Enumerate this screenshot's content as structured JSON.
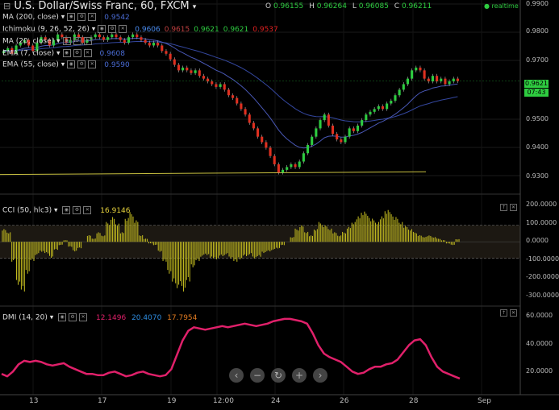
{
  "header": {
    "title": "U.S. Dollar/Swiss Franc, 60, FXCM",
    "ohlc": {
      "o_label": "O",
      "o": "0.96155",
      "h_label": "H",
      "h": "0.96264",
      "l_label": "L",
      "l": "0.96085",
      "c_label": "C",
      "c": "0.96211"
    },
    "realtime": "realtime"
  },
  "indicators": [
    {
      "label": "MA (200, close)",
      "values": [
        "0.9542"
      ],
      "colors": [
        "#4a6cd4"
      ]
    },
    {
      "label": "Ichimoku (9, 26, 52, 26)",
      "values": [
        "0.9606",
        "0.9615",
        "0.9621",
        "0.9621",
        "0.9537"
      ],
      "colors": [
        "#4a8cf0",
        "#c04040",
        "#2ecc40",
        "#2ecc40",
        "#e02020"
      ]
    },
    {
      "label": "MA (20, close)",
      "values": [],
      "colors": []
    },
    {
      "label": "EMA (7, close)",
      "values": [
        "0.9608"
      ],
      "colors": [
        "#4a6cd4"
      ]
    },
    {
      "label": "EMA (55, close)",
      "values": [
        "0.9590"
      ],
      "colors": [
        "#4a6cd4"
      ]
    }
  ],
  "cci_panel": {
    "label": "CCI (50, hlc3)",
    "value": "16.9146",
    "value_color": "#e6d23c"
  },
  "dmi_panel": {
    "label": "DMI (14, 20)",
    "values": [
      "12.1496",
      "20.4070",
      "17.7954"
    ],
    "colors": [
      "#e0206a",
      "#2e8ce0",
      "#e07a20"
    ]
  },
  "price_axis": {
    "ticks": [
      "0.9900",
      "0.9800",
      "0.9700",
      "0.9500",
      "0.9400",
      "0.9300"
    ],
    "price_tag": "0.9621",
    "time_tag": "07:43"
  },
  "cci_axis": {
    "ticks": [
      "200.0000",
      "100.0000",
      "0.0000",
      "-100.0000",
      "-200.0000",
      "-300.0000"
    ]
  },
  "dmi_axis": {
    "ticks": [
      "60.0000",
      "40.0000",
      "20.0000"
    ]
  },
  "x_axis": {
    "ticks": [
      "13",
      "17",
      "19",
      "12:00",
      "24",
      "26",
      "28",
      "Sep"
    ]
  },
  "nav_buttons": [
    "‹",
    "−",
    "↻",
    "+",
    "›"
  ],
  "colors": {
    "bull": "#2ecc40",
    "bear": "#e03020",
    "ma": "#3a4fb0",
    "trend": "#c8c040",
    "cci": "#c8c020",
    "dmi": "#e0206a"
  },
  "chart_data": [
    {
      "type": "candlestick",
      "title": "U.S. Dollar/Swiss Franc, 60, FXCM",
      "ylim": [
        0.925,
        0.99
      ],
      "close": [
        0.973,
        0.974,
        0.972,
        0.975,
        0.976,
        0.977,
        0.975,
        0.973,
        0.976,
        0.978,
        0.977,
        0.975,
        0.977,
        0.979,
        0.978,
        0.976,
        0.977,
        0.979,
        0.978,
        0.976,
        0.977,
        0.978,
        0.979,
        0.978,
        0.977,
        0.978,
        0.979,
        0.978,
        0.977,
        0.976,
        0.978,
        0.979,
        0.978,
        0.977,
        0.976,
        0.975,
        0.976,
        0.975,
        0.973,
        0.972,
        0.97,
        0.968,
        0.966,
        0.967,
        0.966,
        0.965,
        0.966,
        0.964,
        0.963,
        0.962,
        0.961,
        0.96,
        0.961,
        0.959,
        0.957,
        0.956,
        0.954,
        0.952,
        0.95,
        0.947,
        0.945,
        0.942,
        0.94,
        0.938,
        0.935,
        0.932,
        0.929,
        0.93,
        0.931,
        0.932,
        0.931,
        0.933,
        0.936,
        0.939,
        0.942,
        0.945,
        0.948,
        0.95,
        0.946,
        0.943,
        0.941,
        0.94,
        0.942,
        0.945,
        0.944,
        0.946,
        0.948,
        0.95,
        0.951,
        0.952,
        0.953,
        0.952,
        0.954,
        0.955,
        0.957,
        0.959,
        0.961,
        0.963,
        0.966,
        0.967,
        0.966,
        0.963,
        0.962,
        0.964,
        0.962,
        0.963,
        0.961,
        0.962,
        0.963,
        0.9621
      ]
    },
    {
      "type": "bar",
      "series": [
        {
          "name": "CCI (50, hlc3)",
          "values": [
            80,
            60,
            -120,
            -260,
            -300,
            -200,
            -120,
            -80,
            -60,
            -70,
            -100,
            -50,
            -20,
            10,
            -30,
            -60,
            -40,
            0,
            40,
            20,
            60,
            40,
            120,
            150,
            110,
            60,
            150,
            180,
            130,
            40,
            20,
            -10,
            -20,
            -60,
            -120,
            -200,
            -260,
            -280,
            -300,
            -240,
            -160,
            -120,
            -90,
            -80,
            -100,
            -110,
            -90,
            -80,
            -100,
            -120,
            -110,
            -90,
            -80,
            -100,
            -90,
            -70,
            -60,
            -50,
            -40,
            -20,
            0,
            30,
            80,
            100,
            60,
            40,
            80,
            120,
            100,
            80,
            60,
            40,
            60,
            90,
            120,
            160,
            190,
            170,
            140,
            120,
            160,
            200,
            180,
            150,
            120,
            100,
            80,
            60,
            40,
            30,
            40,
            30,
            20,
            10,
            -10,
            -20,
            16.9146
          ]
        }
      ],
      "ylim": [
        -330,
        230
      ]
    },
    {
      "type": "line",
      "series": [
        {
          "name": "DMI (14, 20)",
          "values": [
            16,
            14,
            18,
            24,
            27,
            26,
            27,
            26,
            24,
            23,
            24,
            25,
            22,
            20,
            18,
            16,
            16,
            15,
            15,
            17,
            18,
            16,
            14,
            15,
            17,
            18,
            16,
            15,
            14,
            15,
            20,
            32,
            44,
            52,
            55,
            54,
            53,
            54,
            55,
            56,
            55,
            56,
            57,
            58,
            57,
            56,
            57,
            58,
            60,
            61,
            62,
            62,
            61,
            60,
            58,
            50,
            40,
            33,
            30,
            28,
            26,
            22,
            18,
            16,
            17,
            20,
            22,
            22,
            24,
            25,
            28,
            34,
            40,
            44,
            45,
            40,
            30,
            22,
            18,
            16,
            14,
            12.1496
          ]
        }
      ],
      "ylim": [
        0,
        70
      ]
    }
  ]
}
